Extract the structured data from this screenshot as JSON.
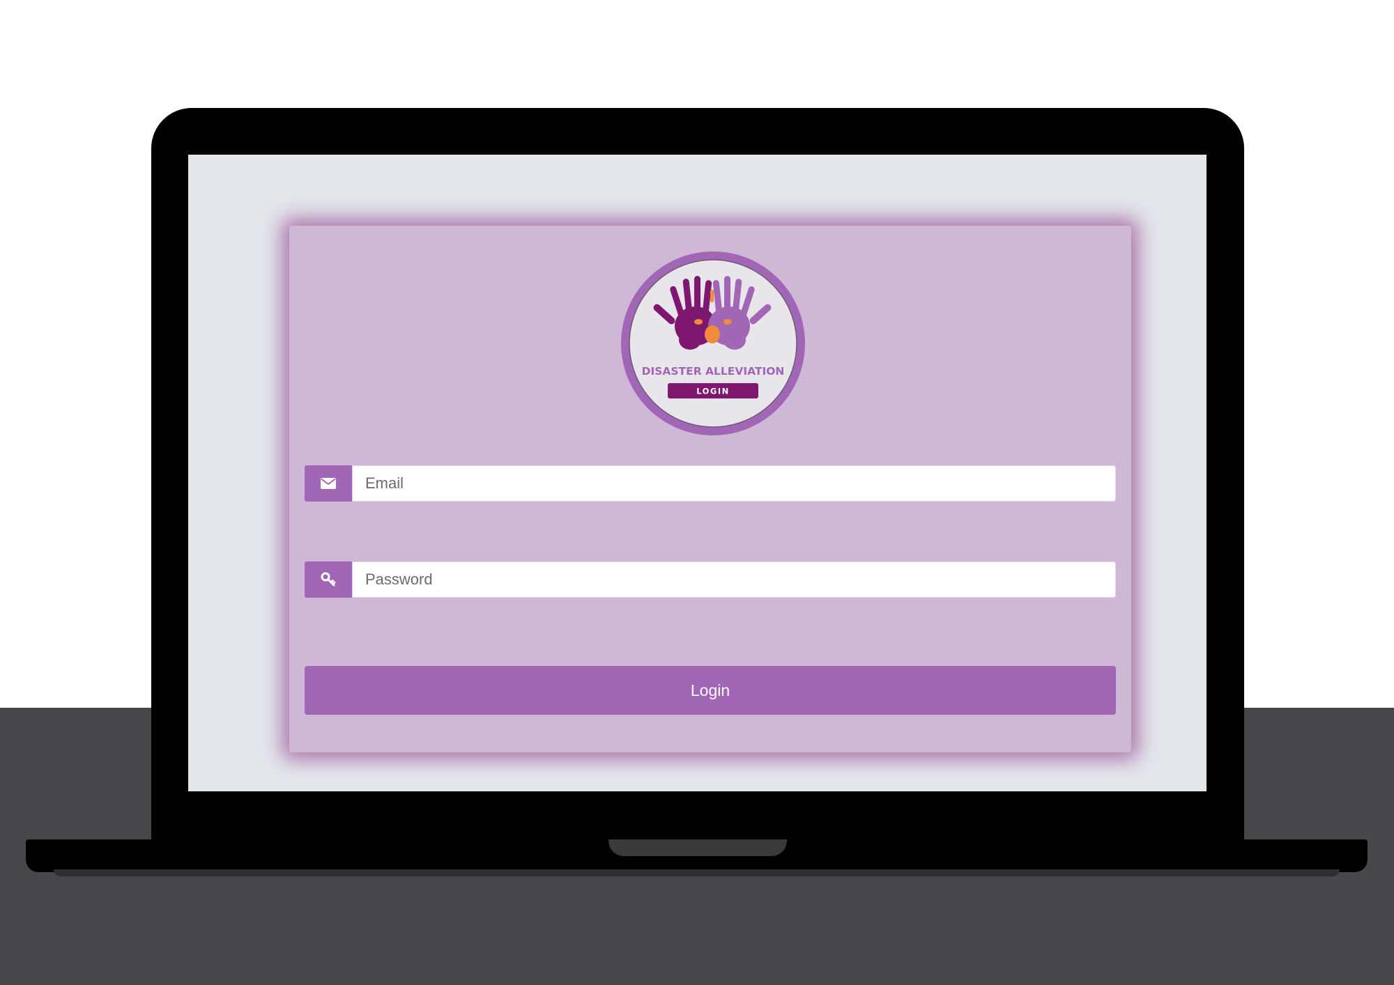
{
  "login_form": {
    "logo": {
      "title": "DISASTER ALLEVIATION",
      "badge": "LOGIN",
      "ring_color": "#a166b5",
      "badge_color": "#7d176f",
      "hand_colors": [
        "#7d176f",
        "#a166b5",
        "#f08a3c"
      ]
    },
    "email": {
      "icon": "envelope-icon",
      "placeholder": "Email",
      "value": ""
    },
    "password": {
      "icon": "key-icon",
      "placeholder": "Password",
      "value": ""
    },
    "submit_label": "Login"
  },
  "colors": {
    "accent": "#a166b5",
    "card_background": "#cfb8d6",
    "page_background": "#e3e6eb",
    "glow": "#7e1878"
  }
}
